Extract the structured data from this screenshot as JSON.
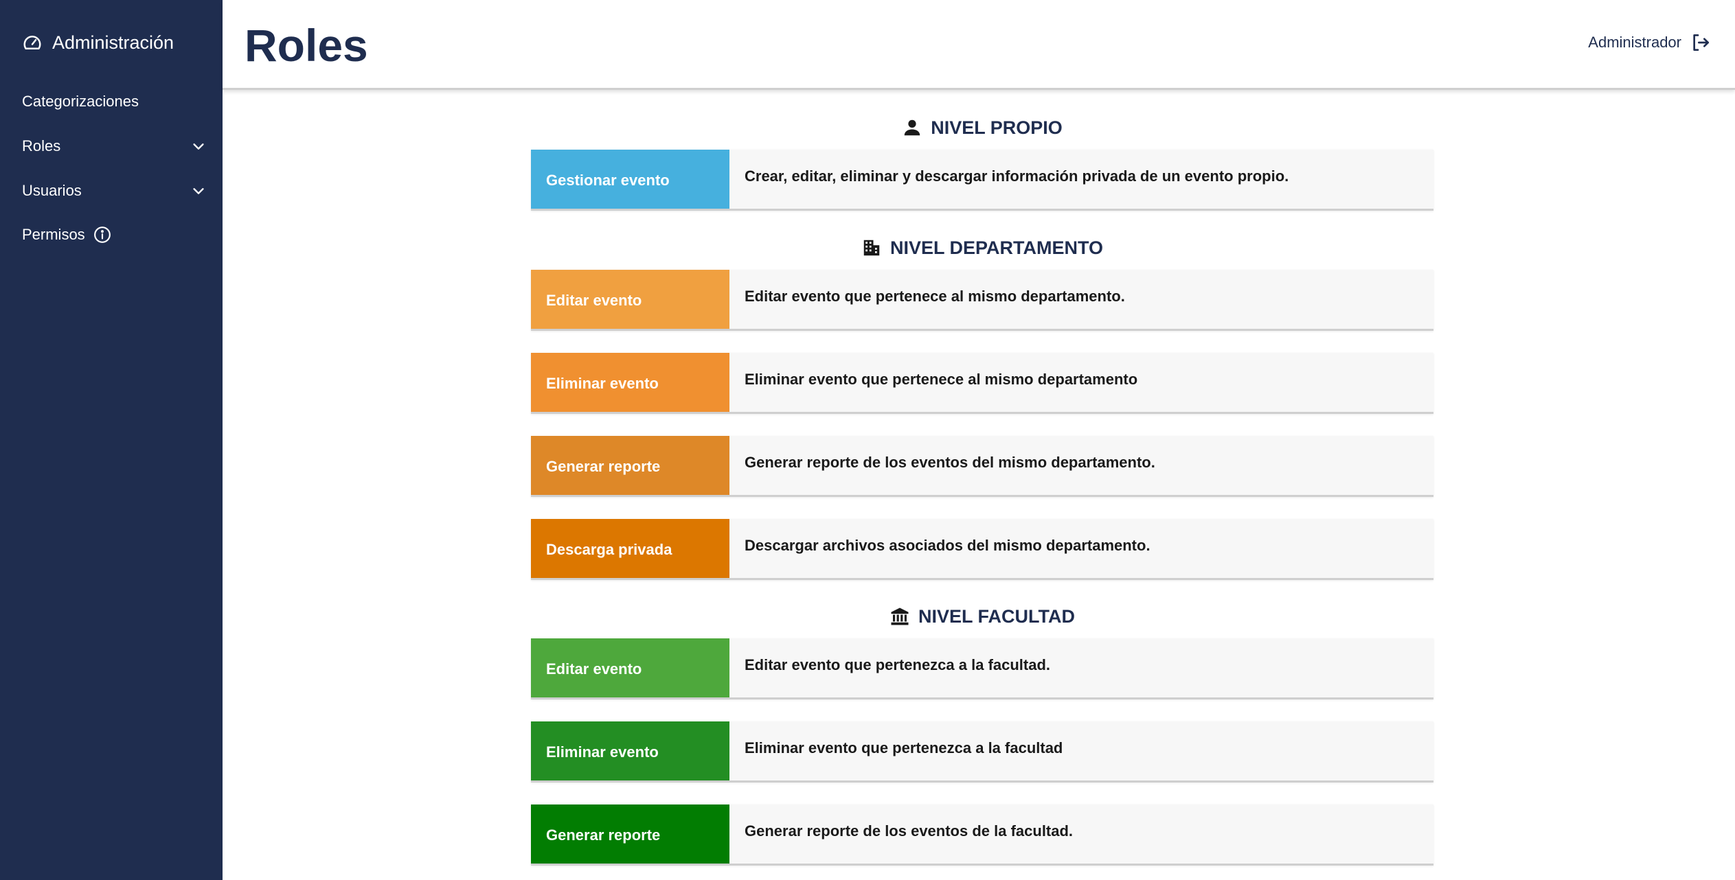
{
  "sidebar": {
    "brand": "Administración",
    "items": [
      {
        "label": "Categorizaciones"
      },
      {
        "label": "Roles"
      },
      {
        "label": "Usuarios"
      },
      {
        "label": "Permisos"
      }
    ]
  },
  "header": {
    "title": "Roles",
    "user": "Administrador"
  },
  "sections": [
    {
      "title": "NIVEL PROPIO",
      "icon": "person-icon",
      "permissions": [
        {
          "name": "Gestionar evento",
          "description": "Crear, editar, eliminar y descargar información privada de un evento propio.",
          "color": "#46b0de"
        }
      ]
    },
    {
      "title": "NIVEL DEPARTAMENTO",
      "icon": "building-icon",
      "permissions": [
        {
          "name": "Editar evento",
          "description": "Editar evento que pertenece al mismo departamento.",
          "color": "#f0a040"
        },
        {
          "name": "Eliminar evento",
          "description": "Eliminar evento que pertenece al mismo departamento",
          "color": "#f09030"
        },
        {
          "name": "Generar reporte",
          "description": "Generar reporte de los eventos del mismo departamento.",
          "color": "#de8828"
        },
        {
          "name": "Descarga privada",
          "description": "Descargar archivos asociados del mismo departamento.",
          "color": "#dc7700"
        }
      ]
    },
    {
      "title": "NIVEL FACULTAD",
      "icon": "institution-icon",
      "permissions": [
        {
          "name": "Editar evento",
          "description": "Editar evento que pertenezca a la facultad.",
          "color": "#4ea83c"
        },
        {
          "name": "Eliminar evento",
          "description": "Eliminar evento que pertenezca a la facultad",
          "color": "#238e23"
        },
        {
          "name": "Generar reporte",
          "description": "Generar reporte de los eventos de la facultad.",
          "color": "#027d02"
        }
      ]
    }
  ]
}
